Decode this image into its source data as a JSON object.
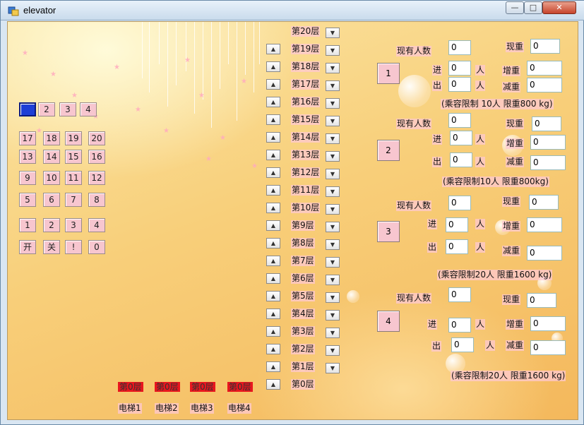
{
  "window": {
    "title": "elevator",
    "min_glyph": "—",
    "max_glyph": "□",
    "close_glyph": "✕"
  },
  "panel": {
    "rowA": [
      "2",
      "3",
      "4"
    ],
    "rowB": [
      "17",
      "18",
      "19",
      "20"
    ],
    "rowC": [
      "13",
      "14",
      "15",
      "16"
    ],
    "rowD": [
      "9",
      "10",
      "11",
      "12"
    ],
    "rowE": [
      "5",
      "6",
      "7",
      "8"
    ],
    "rowF": [
      "1",
      "2",
      "3",
      "4"
    ],
    "rowG": [
      "开",
      "关",
      "!",
      "0"
    ]
  },
  "floors": [
    "第20层",
    "第19层",
    "第18层",
    "第17层",
    "第16层",
    "第15层",
    "第14层",
    "第13层",
    "第12层",
    "第11层",
    "第10层",
    "第9层",
    "第8层",
    "第7层",
    "第6层",
    "第5层",
    "第4层",
    "第3层",
    "第2层",
    "第1层",
    "第0层"
  ],
  "up_glyph": "▲",
  "down_glyph": "▼",
  "status": {
    "floors": [
      "第0层",
      "第0层",
      "第0层",
      "第0层"
    ],
    "names": [
      "电梯1",
      "电梯2",
      "电梯3",
      "电梯4"
    ]
  },
  "elevators": [
    {
      "id": "1",
      "count_label": "现有人数",
      "count": "0",
      "weight_label": "现重",
      "weight": "0",
      "in_label": "进",
      "in": "0",
      "out_label": "出",
      "out": "0",
      "person": "人",
      "add_label": "增重",
      "add": "0",
      "sub_label": "减重",
      "sub": "0",
      "limit": "(乘容限制 10人 限重800 kg)"
    },
    {
      "id": "2",
      "count_label": "现有人数",
      "count": "0",
      "weight_label": "现重",
      "weight": "0",
      "in_label": "进",
      "in": "0",
      "out_label": "出",
      "out": "0",
      "person": "人",
      "add_label": "增重",
      "add": "0",
      "sub_label": "减重",
      "sub": "0",
      "limit": "(乘容限制10人 限重800kg)"
    },
    {
      "id": "3",
      "count_label": "现有人数",
      "count": "0",
      "weight_label": "现重",
      "weight": "0",
      "in_label": "进",
      "in": "0",
      "out_label": "出",
      "out": "0",
      "person": "人",
      "add_label": "增重",
      "add": "0",
      "sub_label": "减重",
      "sub": "0",
      "limit": "(乘容限制20人 限重1600 kg)"
    },
    {
      "id": "4",
      "count_label": "现有人数",
      "count": "0",
      "weight_label": "现重",
      "weight": "0",
      "in_label": "进",
      "in": "0",
      "out_label": "出",
      "out": "0",
      "person": "人",
      "add_label": "增重",
      "add": "0",
      "sub_label": "减重",
      "sub": "0",
      "limit": "(乘容限制20人 限重1600 kg)"
    }
  ]
}
